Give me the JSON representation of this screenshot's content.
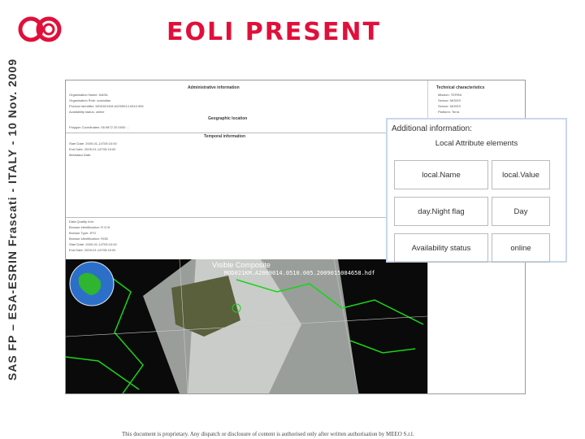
{
  "side_title": "SAS FP – ESA-ESRIN Frascati - ITALY - 10 Nov. 2009",
  "logo": {
    "label": "80",
    "color": "#e0103a"
  },
  "slide_title": "EOLI PRESENT",
  "colors": {
    "accent": "#e0103a",
    "popup_border": "#c7d7ec"
  },
  "doc": {
    "admin_header": "Administrative information",
    "admin_lines": [
      "Organisation Name: NASA",
      "Organisation Role: custodian",
      "Product Identifier: MOD021KM.A2009014.0510.005",
      "Availability status: online"
    ],
    "technical_header": "Technical characteristics",
    "technical_lines": [
      "Mission: TERRA",
      "Sensor: MODIS",
      "Sensor: MODIS",
      "Platform: Terra"
    ],
    "geo_header": "Geographic location",
    "polygon_line": "Polygon Coordinates: 55.9872  20.0000 …",
    "temporal_header": "Temporal information",
    "temporal_lines": [
      "Start Date: 2009-01-14T05:10:00",
      "End Date: 2009-01-14T05:15:00",
      "Metadata Date:"
    ],
    "quality_lines": [
      "Data Quality Info:",
      "Browse Identification: R G B",
      "Browse Type: JPG",
      "Browse Identification: RGB",
      "Start Date: 2009-01-14T05:10:00",
      "End Date: 2009-01-14T05:15:00"
    ],
    "sat_caption": "Visible Composite",
    "sat_file": "MOD021KM.A2009014.0510.005.2009015084658.hdf"
  },
  "popup": {
    "title": "Additional information:",
    "subtitle": "Local Attribute elements",
    "header": {
      "name": "local.Name",
      "value": "local.Value"
    },
    "rows": [
      {
        "name": "day.Night flag",
        "value": "Day"
      },
      {
        "name": "Availability status",
        "value": "online"
      }
    ]
  },
  "footer": "This document is proprietary. Any dispatch or disclosure of content is authorised only after written authorisation by MEEO S.r.l."
}
